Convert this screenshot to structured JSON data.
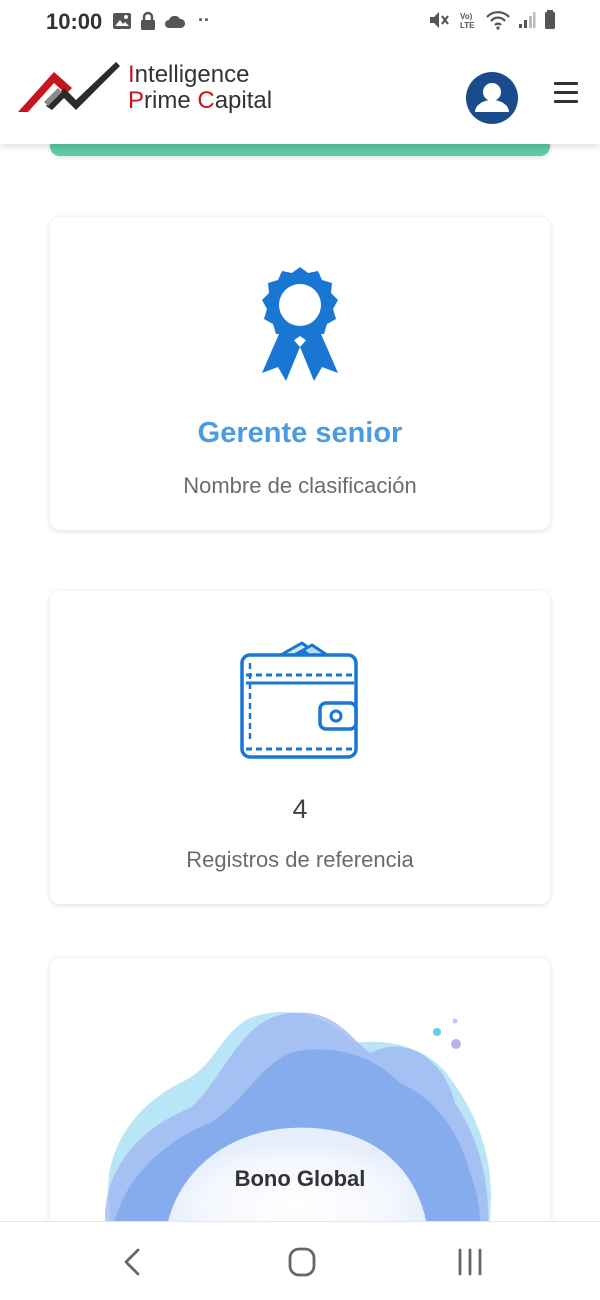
{
  "status_bar": {
    "time": "10:00",
    "dots": "··"
  },
  "header": {
    "logo_line1_initial": "I",
    "logo_line1_rest": "ntelligence",
    "logo_line2_initial_p": "P",
    "logo_line2_rime": "rime ",
    "logo_line2_initial_c": "C",
    "logo_line2_apital": "apital"
  },
  "cards": {
    "rank": {
      "value": "Gerente senior",
      "label": "Nombre de clasificación"
    },
    "referrals": {
      "value": "4",
      "label": "Registros de referencia"
    },
    "bonus": {
      "title": "Bono Global"
    }
  },
  "colors": {
    "accent": "#4a9be2",
    "icon_blue": "#1976d2",
    "brand_red": "#c4161c",
    "strip_green": "#5cc9a7",
    "avatar_navy": "#1a4b8c"
  },
  "icons": {
    "rank": "award-ribbon-icon",
    "referrals": "wallet-icon",
    "profile": "user-avatar-icon",
    "menu": "hamburger-menu-icon"
  }
}
